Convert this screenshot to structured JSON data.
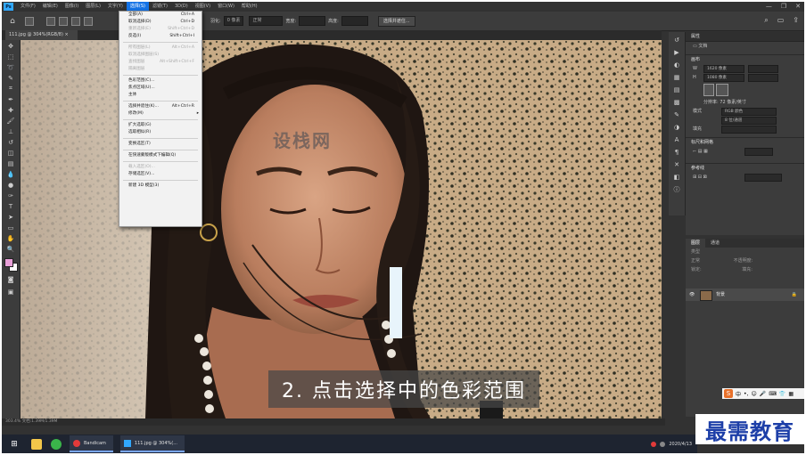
{
  "menubar": {
    "items": [
      "文件(F)",
      "编辑(E)",
      "图像(I)",
      "图层(L)",
      "文字(Y)",
      "选择(S)",
      "滤镜(T)",
      "3D(D)",
      "视图(V)",
      "窗口(W)",
      "帮助(H)"
    ],
    "active_index": 5,
    "controls": [
      "—",
      "❐",
      "✕"
    ]
  },
  "optionsbar": {
    "feather_label": "羽化:",
    "feather_value": "0 像素",
    "style_value": "正常",
    "width_label": "宽度:",
    "height_label": "高度:",
    "select_mask_button": "选择并遮住..."
  },
  "document": {
    "tab_title": "111.jpg @ 304%(RGB/8) ×",
    "status": "303.4%   文档:1.39M/1.39M",
    "subtitle": "2. 点击选择中的色彩范围",
    "watermark": "设栈网"
  },
  "select_menu": {
    "items": [
      {
        "label": "全部(A)",
        "shortcut": "Ctrl+A",
        "disabled": false
      },
      {
        "label": "取消选择(D)",
        "shortcut": "Ctrl+D",
        "disabled": false
      },
      {
        "label": "重新选择(E)",
        "shortcut": "Shift+Ctrl+D",
        "disabled": true
      },
      {
        "label": "反选(I)",
        "shortcut": "Shift+Ctrl+I",
        "disabled": false
      },
      {
        "sep": true
      },
      {
        "label": "所有图层(L)",
        "shortcut": "Alt+Ctrl+A",
        "disabled": true
      },
      {
        "label": "取消选择图层(S)",
        "shortcut": "",
        "disabled": true
      },
      {
        "label": "查找图层",
        "shortcut": "Alt+Shift+Ctrl+F",
        "disabled": true
      },
      {
        "label": "隔离图层",
        "shortcut": "",
        "disabled": true
      },
      {
        "sep": true
      },
      {
        "label": "色彩范围(C)...",
        "shortcut": "",
        "disabled": false
      },
      {
        "label": "焦点区域(U)...",
        "shortcut": "",
        "disabled": false
      },
      {
        "label": "主体",
        "shortcut": "",
        "disabled": false
      },
      {
        "sep": true
      },
      {
        "label": "选择并遮住(K)...",
        "shortcut": "Alt+Ctrl+R",
        "disabled": false
      },
      {
        "label": "修改(M)",
        "shortcut": "",
        "disabled": false,
        "submenu": true
      },
      {
        "sep": true
      },
      {
        "label": "扩大选取(G)",
        "shortcut": "",
        "disabled": false
      },
      {
        "label": "选取相似(R)",
        "shortcut": "",
        "disabled": false
      },
      {
        "sep": true
      },
      {
        "label": "变换选区(T)",
        "shortcut": "",
        "disabled": false
      },
      {
        "sep": true
      },
      {
        "label": "在快速蒙版模式下编辑(Q)",
        "shortcut": "",
        "disabled": false
      },
      {
        "sep": true
      },
      {
        "label": "载入选区(O)...",
        "shortcut": "",
        "disabled": true
      },
      {
        "label": "存储选区(V)...",
        "shortcut": "",
        "disabled": false
      },
      {
        "sep": true
      },
      {
        "label": "新建 3D 模型(3)",
        "shortcut": "",
        "disabled": false
      }
    ]
  },
  "properties": {
    "header": "属性",
    "doc_label": "文档",
    "canvas_label": "画布",
    "w_value": "1620 像素",
    "h_value": "1080 像素",
    "resolution": "分辨率: 72 像素/英寸",
    "mode_label": "模式",
    "mode_value": "RGB 颜色",
    "bit_value": "8 位/通道",
    "fill_label": "填充",
    "rulers_section": "标尺和网格",
    "guides_section": "参考线"
  },
  "layers": {
    "tabs": [
      "图层",
      "通道"
    ],
    "filter_label": "类型",
    "blend_value": "正常",
    "opacity_label": "不透明度:",
    "lock_label": "锁定:",
    "fill_label": "填充:",
    "layer_name": "背景"
  },
  "taskbar": {
    "bandicam": "Bandicam",
    "ps_task": "111.jpg @ 304%(...",
    "time": "2020/4/13"
  },
  "brand": "最需教育"
}
